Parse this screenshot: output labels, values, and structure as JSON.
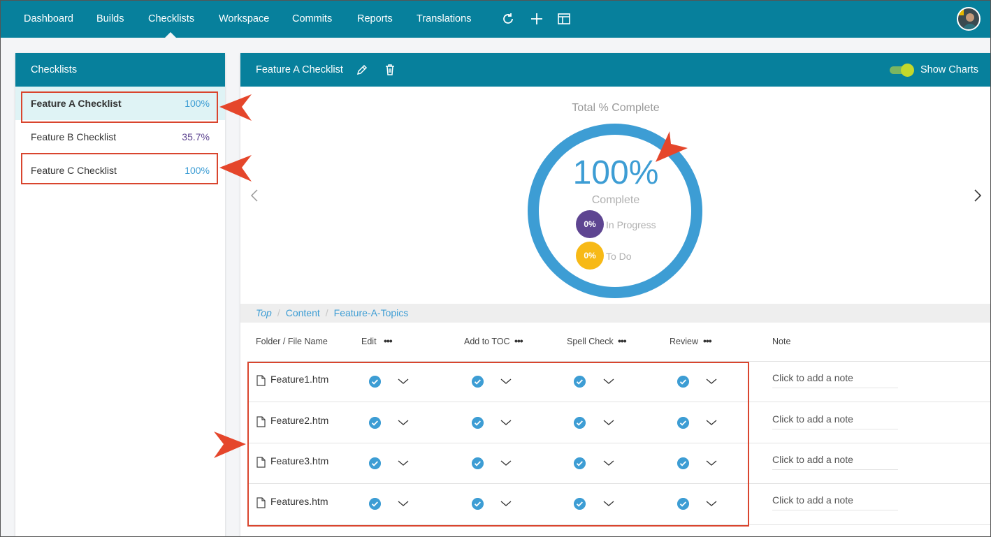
{
  "nav": {
    "items": [
      "Dashboard",
      "Builds",
      "Checklists",
      "Workspace",
      "Commits",
      "Reports",
      "Translations"
    ],
    "active": "Checklists",
    "icons": [
      "refresh-icon",
      "plus-icon",
      "layout-icon"
    ]
  },
  "sidebar": {
    "title": "Checklists",
    "items": [
      {
        "label": "Feature A Checklist",
        "pct": "100%"
      },
      {
        "label": "Feature B Checklist",
        "pct": "35.7%"
      },
      {
        "label": "Feature C Checklist",
        "pct": "100%"
      }
    ]
  },
  "main": {
    "title": "Feature A Checklist",
    "show_charts_label": "Show Charts",
    "show_charts_on": true,
    "chart": {
      "title": "Total % Complete",
      "pct_complete": "100%",
      "complete_label": "Complete",
      "in_progress_pct": "0%",
      "in_progress_label": "In Progress",
      "todo_pct": "0%",
      "todo_label": "To Do"
    },
    "breadcrumb": [
      "Top",
      "Content",
      "Feature-A-Topics"
    ],
    "columns": {
      "file": "Folder / File Name",
      "edit": "Edit",
      "toc": "Add to TOC",
      "spell": "Spell Check",
      "review": "Review",
      "note": "Note"
    },
    "rows": [
      {
        "file": "Feature1.htm",
        "note": "Click to add a note"
      },
      {
        "file": "Feature2.htm",
        "note": "Click to add a note"
      },
      {
        "file": "Feature3.htm",
        "note": "Click to add a note"
      },
      {
        "file": "Features.htm",
        "note": "Click to add a note"
      }
    ]
  },
  "colors": {
    "brand": "#07809c",
    "accent_blue": "#3d9dd4",
    "in_progress": "#5e4591",
    "todo": "#f7b916",
    "callout": "#d9452e"
  },
  "chart_data": {
    "type": "pie",
    "title": "Total % Complete",
    "categories": [
      "Complete",
      "In Progress",
      "To Do"
    ],
    "values": [
      100,
      0,
      0
    ]
  }
}
